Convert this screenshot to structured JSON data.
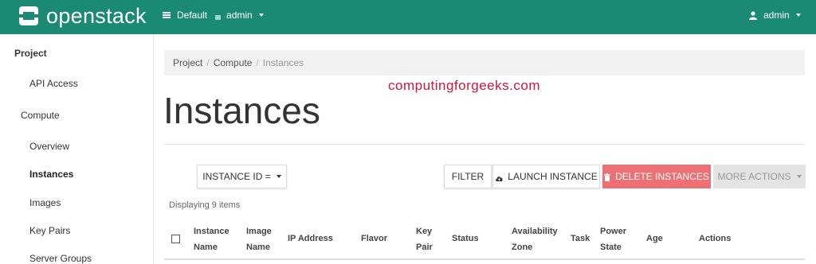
{
  "brand": {
    "name": "openstack",
    "color": "#1a8a74"
  },
  "topbar": {
    "domain_label": "Default",
    "project_label": "admin",
    "user_label": "admin"
  },
  "sidebar": {
    "project": "Project",
    "api_access": "API Access",
    "compute": "Compute",
    "overview": "Overview",
    "instances": "Instances",
    "images": "Images",
    "key_pairs": "Key Pairs",
    "server_groups": "Server Groups"
  },
  "breadcrumb": {
    "items": [
      "Project",
      "Compute",
      "Instances"
    ]
  },
  "watermark": "computingforgeeks.com",
  "page": {
    "title": "Instances"
  },
  "toolbar": {
    "filter_field": "INSTANCE ID =",
    "filter": "FILTER",
    "launch": "LAUNCH INSTANCE",
    "delete": "DELETE INSTANCES",
    "more": "MORE ACTIONS",
    "delete_color": "#ec7074"
  },
  "table": {
    "displaying": "Displaying 9 items",
    "columns": [
      [
        "Instance",
        "Name"
      ],
      [
        "Image",
        "Name"
      ],
      [
        "IP Address"
      ],
      [
        "Flavor"
      ],
      [
        "Key",
        "Pair"
      ],
      [
        "Status"
      ],
      [
        "Availability",
        "Zone"
      ],
      [
        "Task"
      ],
      [
        "Power",
        "State"
      ],
      [
        "Age"
      ],
      [
        "Actions"
      ]
    ]
  },
  "icons": [
    "openstack-logo-icon",
    "domain-icon",
    "project-icon",
    "user-icon",
    "cloud-upload-icon",
    "trash-icon",
    "checkbox-icon"
  ]
}
